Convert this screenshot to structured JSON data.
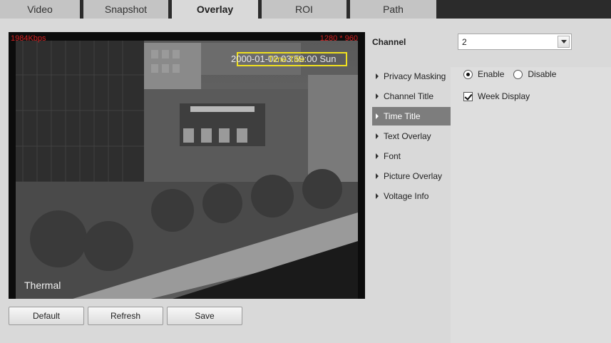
{
  "tabs": [
    {
      "label": "Video"
    },
    {
      "label": "Snapshot"
    },
    {
      "label": "Overlay"
    },
    {
      "label": "ROI"
    },
    {
      "label": "Path"
    }
  ],
  "active_tab": "Overlay",
  "preview": {
    "bitrate": "1984Kbps",
    "resolution": "1280 * 960",
    "timestamp": "2000-01-02 03:59:00 Sun",
    "time_title_label": "Time Title",
    "channel_name": "Thermal",
    "box_color": "#f0e020",
    "stat_color": "#d42020"
  },
  "buttons": {
    "default": "Default",
    "refresh": "Refresh",
    "save": "Save"
  },
  "channel": {
    "label": "Channel",
    "value": "2"
  },
  "menu": [
    {
      "label": "Privacy Masking"
    },
    {
      "label": "Channel Title"
    },
    {
      "label": "Time Title"
    },
    {
      "label": "Text Overlay"
    },
    {
      "label": "Font"
    },
    {
      "label": "Picture Overlay"
    },
    {
      "label": "Voltage Info"
    }
  ],
  "active_menu": "Time Title",
  "settings": {
    "enable_label": "Enable",
    "disable_label": "Disable",
    "enabled": true,
    "week_display_label": "Week Display",
    "week_display_checked": true
  }
}
